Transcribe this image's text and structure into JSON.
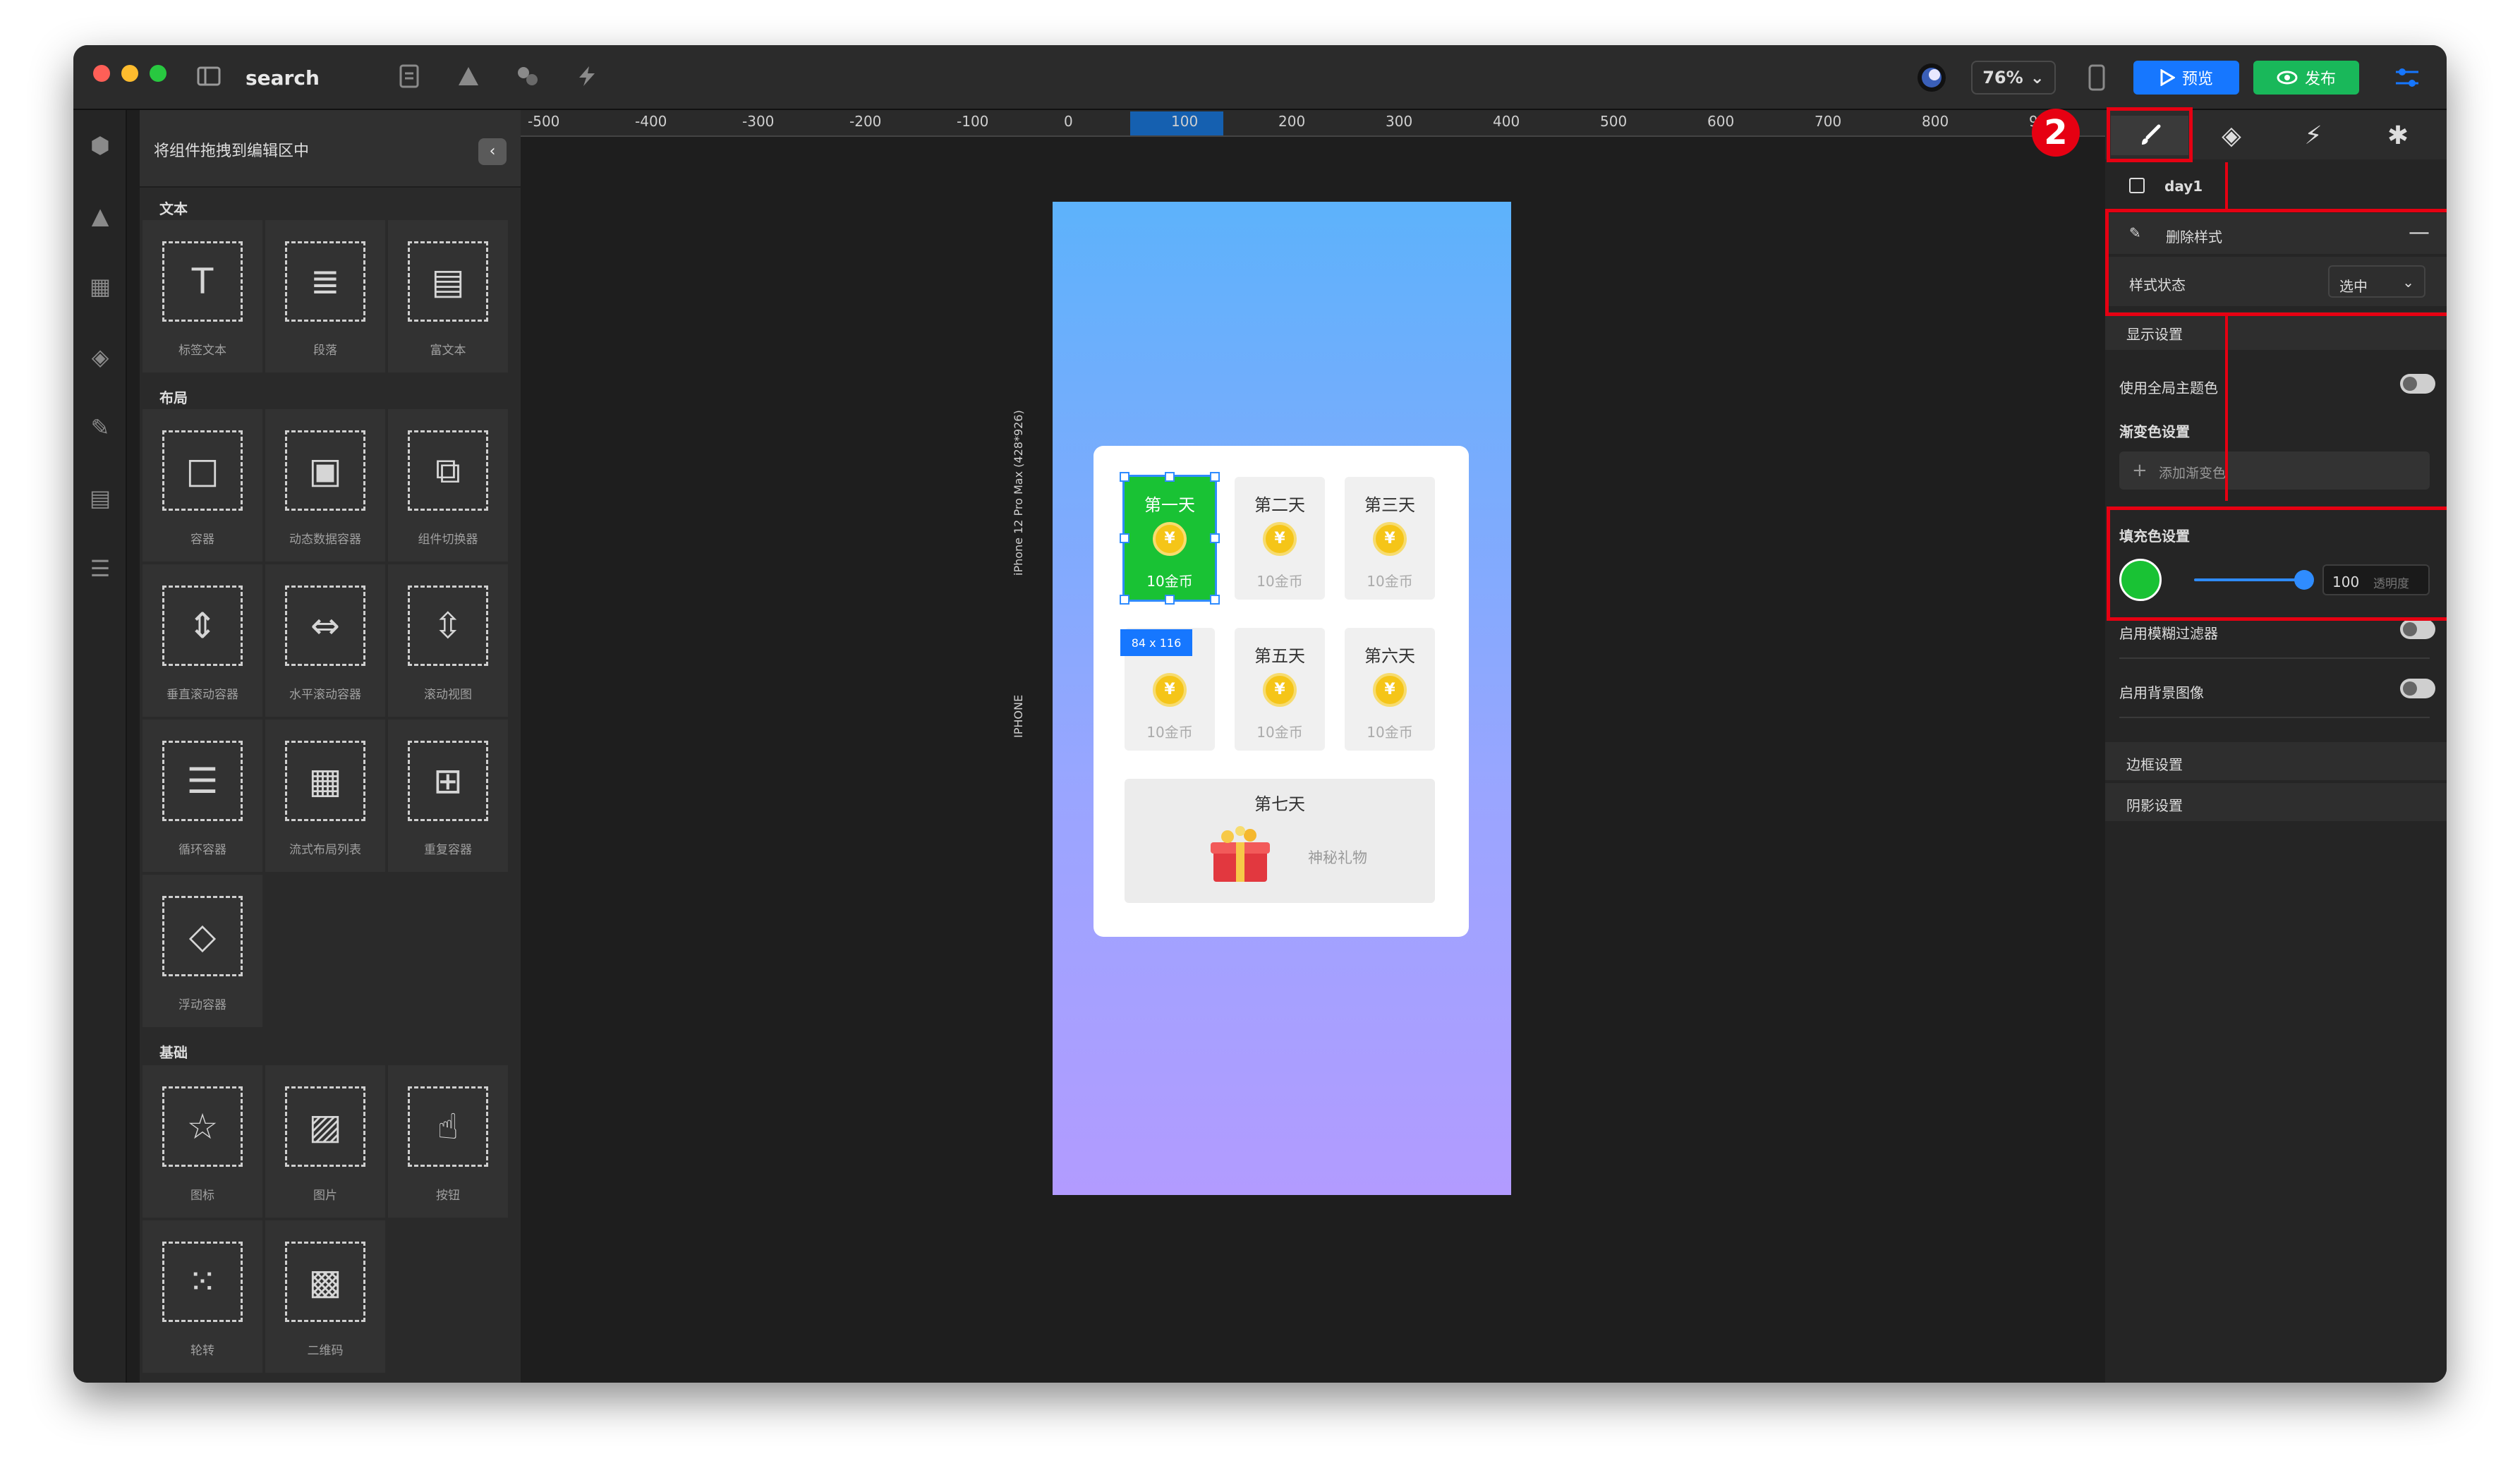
{
  "app": {
    "search_label": "search"
  },
  "toolbar": {
    "zoom": "76%",
    "preview": "预览",
    "publish": "发布"
  },
  "components_panel": {
    "header": "将组件拖拽到编辑区中",
    "sections": [
      {
        "title": "文本",
        "items": [
          "标签文本",
          "段落",
          "富文本"
        ]
      },
      {
        "title": "布局",
        "items": [
          "容器",
          "动态数据容器",
          "组件切换器",
          "垂直滚动容器",
          "水平滚动容器",
          "滚动视图",
          "循环容器",
          "流式布局列表",
          "重复容器",
          "浮动容器"
        ]
      },
      {
        "title": "基础",
        "items": [
          "图标",
          "图片",
          "按钮",
          "轮转",
          "二维码"
        ]
      }
    ]
  },
  "ruler": {
    "ticks": [
      "-500",
      "-400",
      "-300",
      "-200",
      "-100",
      "0",
      "100",
      "200",
      "300",
      "400",
      "500",
      "600",
      "700",
      "800",
      "900"
    ]
  },
  "canvas": {
    "device_label": "iPhone 12 Pro Max (428*926)",
    "device_type": "IPHONE",
    "selection_toolbar_label": "day1",
    "size_badge": "84 x 116",
    "days": [
      {
        "name": "第一天",
        "reward": "10金币",
        "active": true
      },
      {
        "name": "第二天",
        "reward": "10金币"
      },
      {
        "name": "第三天",
        "reward": "10金币"
      },
      {
        "name": "第五天",
        "reward": "10金币"
      },
      {
        "name": "第六天",
        "reward": "10金币"
      }
    ],
    "coin_symbol": "¥",
    "day7": {
      "name": "第七天",
      "reward": "神秘礼物"
    }
  },
  "properties": {
    "step_number": "2",
    "layer_name": "day1",
    "delete_style": "删除样式",
    "style_state_label": "样式状态",
    "style_state_value": "选中",
    "display_settings": "显示设置",
    "use_global_theme": "使用全局主题色",
    "gradient_settings": "渐变色设置",
    "add_gradient": "添加渐变色",
    "fill_settings": "填充色设置",
    "fill_color": "#19c234",
    "opacity_value": "100",
    "opacity_placeholder": "透明度",
    "blur_filter": "启用模糊过滤器",
    "background_image": "启用背景图像",
    "border_settings": "边框设置",
    "shadow_settings": "阴影设置"
  }
}
